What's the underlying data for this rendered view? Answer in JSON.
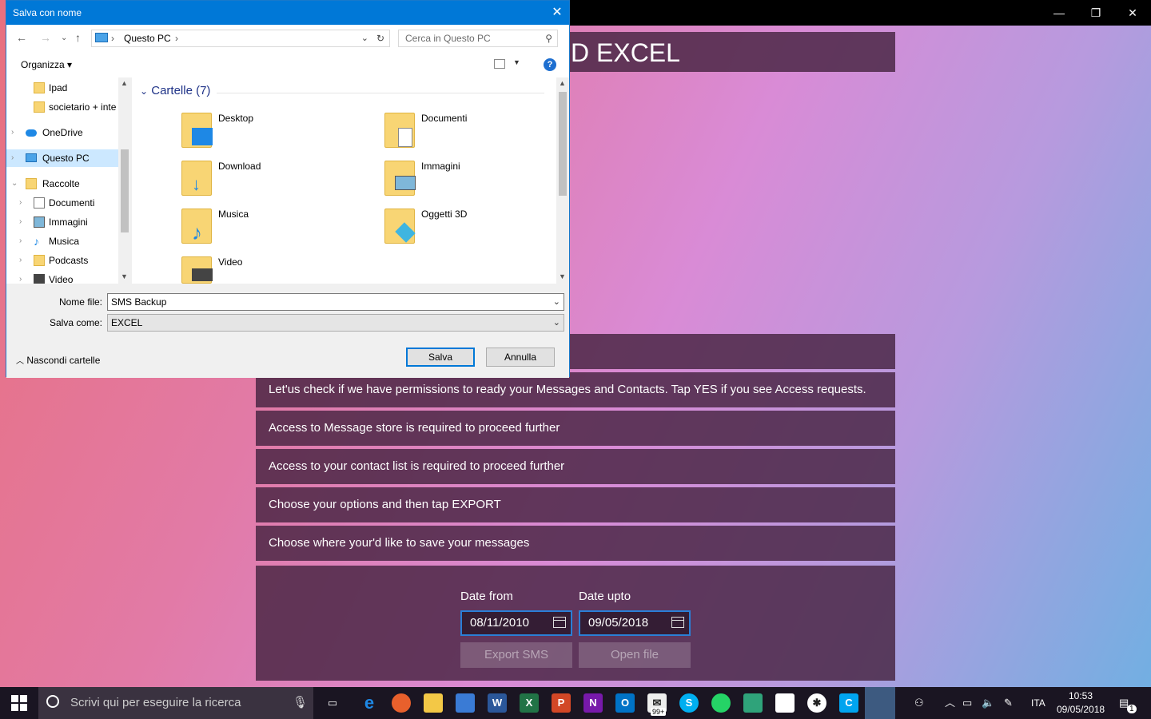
{
  "app": {
    "title": "D EXCEL",
    "window_controls": {
      "minimize": "—",
      "maximize": "❐",
      "close": "✕"
    },
    "steps": [
      "",
      "Let'us check if we have permissions to ready your Messages and Contacts. Tap YES if you see Access requests.",
      "Access to Message store is required to proceed further",
      "Access to your contact list is required to proceed further",
      "Choose your options and then tap EXPORT",
      "Choose where your'd like to save your messages"
    ],
    "date_from_label": "Date from",
    "date_from_value": "08/11/2010",
    "date_upto_label": "Date upto",
    "date_upto_value": "09/05/2018",
    "export_button": "Export SMS",
    "open_button": "Open file"
  },
  "dialog": {
    "title": "Salva con nome",
    "close": "✕",
    "address": {
      "pc_label": "Questo PC"
    },
    "search_placeholder": "Cerca in Questo PC",
    "organize": "Organizza ▾",
    "help": "?",
    "nav_tree": [
      {
        "label": "Ipad",
        "chev": "",
        "indent": 1
      },
      {
        "label": "societario + inte",
        "chev": "",
        "indent": 1
      },
      {
        "label": "OneDrive",
        "chev": "›",
        "indent": 0
      },
      {
        "label": "Questo PC",
        "chev": "›",
        "indent": 0,
        "selected": true
      },
      {
        "label": "Raccolte",
        "chev": "⌄",
        "indent": 0
      },
      {
        "label": "Documenti",
        "chev": "›",
        "indent": 1
      },
      {
        "label": "Immagini",
        "chev": "›",
        "indent": 1
      },
      {
        "label": "Musica",
        "chev": "›",
        "indent": 1
      },
      {
        "label": "Podcasts",
        "chev": "›",
        "indent": 1
      },
      {
        "label": "Video",
        "chev": "›",
        "indent": 1
      }
    ],
    "group_header": "Cartelle (7)",
    "folders": [
      {
        "name": "Desktop",
        "badge": "#1e88e5"
      },
      {
        "name": "Documenti",
        "badge": "#ffffff"
      },
      {
        "name": "Download",
        "badge": "#1e88e5"
      },
      {
        "name": "Immagini",
        "badge": "#7fb7d9"
      },
      {
        "name": "Musica",
        "badge": "#1e88e5"
      },
      {
        "name": "Oggetti 3D",
        "badge": "#3fb5e0"
      },
      {
        "name": "Video",
        "badge": "#444444"
      }
    ],
    "filename_label": "Nome file:",
    "filename_value": "SMS Backup",
    "savetype_label": "Salva come:",
    "savetype_value": "EXCEL",
    "hide_folders": "Nascondi cartelle",
    "save_button": "Salva",
    "cancel_button": "Annulla"
  },
  "taskbar": {
    "search_placeholder": "Scrivi qui per eseguire la ricerca",
    "language": "ITA",
    "time": "10:53",
    "date": "09/05/2018",
    "mail_badge": "99+",
    "notification_badge": "1"
  }
}
